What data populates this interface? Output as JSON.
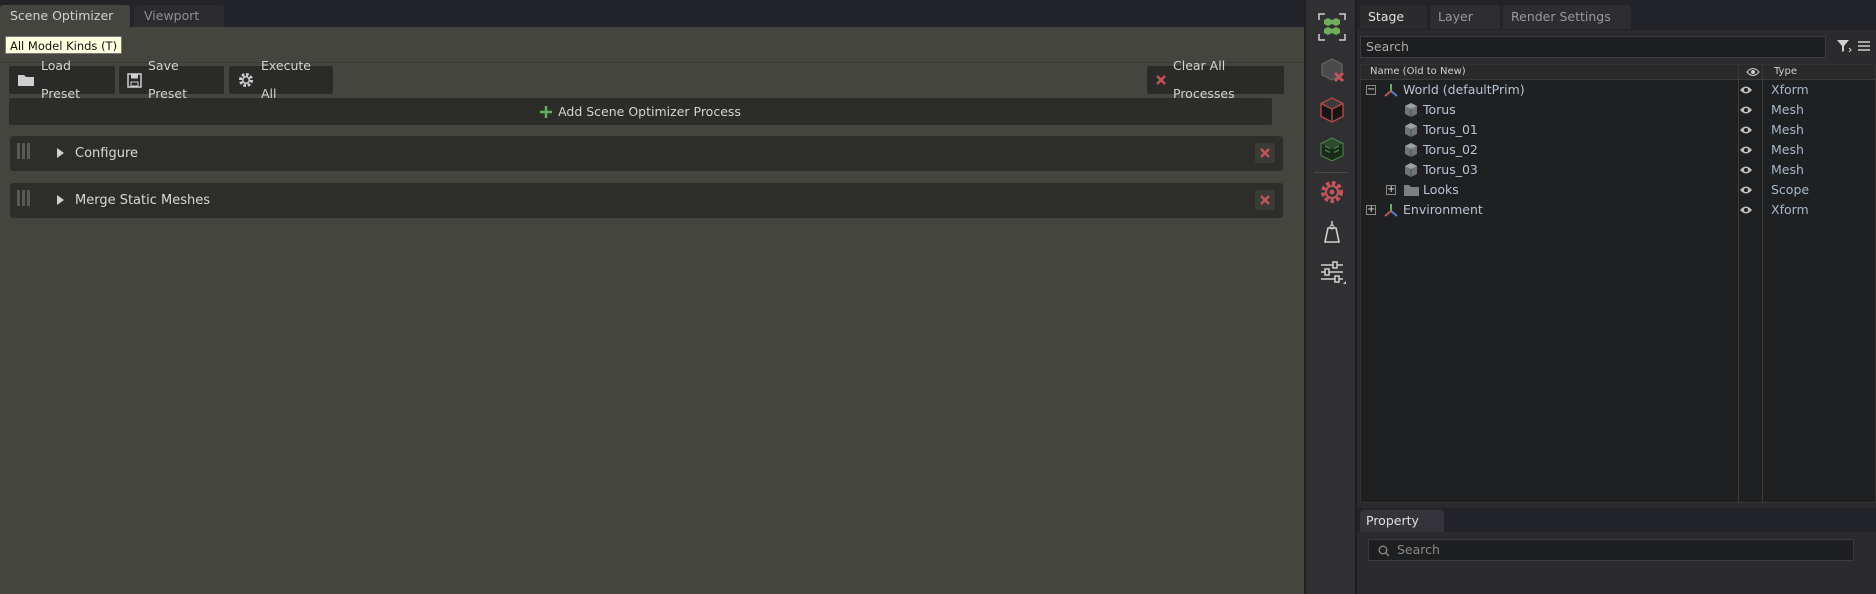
{
  "left_panel": {
    "tabs": [
      "Scene Optimizer",
      "Viewport"
    ],
    "tooltip": "All Model Kinds (T)",
    "buttons": {
      "load_preset": "Load Preset",
      "save_preset": "Save Preset",
      "execute_all": "Execute All",
      "clear_all": "Clear All Processes"
    },
    "add_process": "Add Scene Optimizer Process",
    "processes": [
      "Configure",
      "Merge Static Meshes"
    ]
  },
  "stage": {
    "tabs": [
      "Stage",
      "Layer",
      "Render Settings"
    ],
    "search_placeholder": "Search",
    "columns": {
      "name": "Name (Old to New)",
      "type": "Type"
    },
    "rows": [
      {
        "name": "World (defaultPrim)",
        "type": "Xform",
        "expand": "−"
      },
      {
        "name": "Torus",
        "type": "Mesh"
      },
      {
        "name": "Torus_01",
        "type": "Mesh"
      },
      {
        "name": "Torus_02",
        "type": "Mesh"
      },
      {
        "name": "Torus_03",
        "type": "Mesh"
      },
      {
        "name": "Looks",
        "type": "Scope",
        "expand": "+"
      },
      {
        "name": "Environment",
        "type": "Xform",
        "expand": "+"
      }
    ]
  },
  "property": {
    "tab": "Property",
    "search_placeholder": "Search"
  },
  "colors": {
    "accent_red": "#c0555a",
    "add_green": "#5fb35f",
    "tooltip_bg": "#ffffe0"
  }
}
